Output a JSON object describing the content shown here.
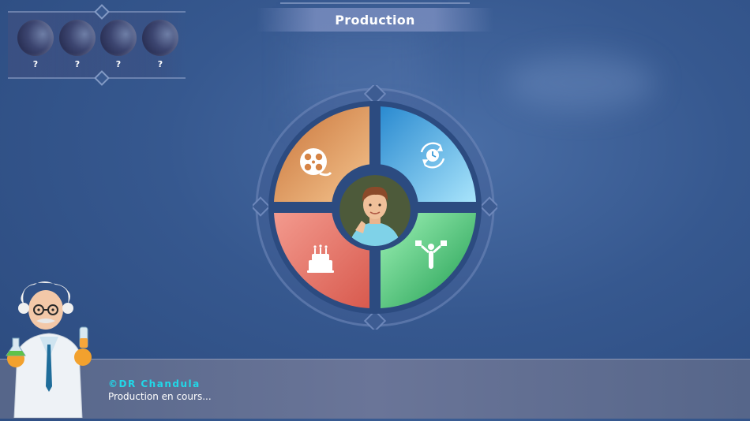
{
  "header": {
    "title": "Production"
  },
  "players": [
    {
      "label": "?"
    },
    {
      "label": "?"
    },
    {
      "label": "?"
    },
    {
      "label": "?"
    }
  ],
  "wheel": {
    "segments": [
      {
        "icon": "film-reel-icon",
        "color": "#e08a4a"
      },
      {
        "icon": "clock-cycle-icon",
        "color": "#3aa8e0"
      },
      {
        "icon": "birthday-cake-icon",
        "color": "#e87a72"
      },
      {
        "icon": "person-flags-icon",
        "color": "#2fb865"
      }
    ]
  },
  "dialog": {
    "speaker": "©DR Chandula",
    "message": "Production en cours..."
  }
}
